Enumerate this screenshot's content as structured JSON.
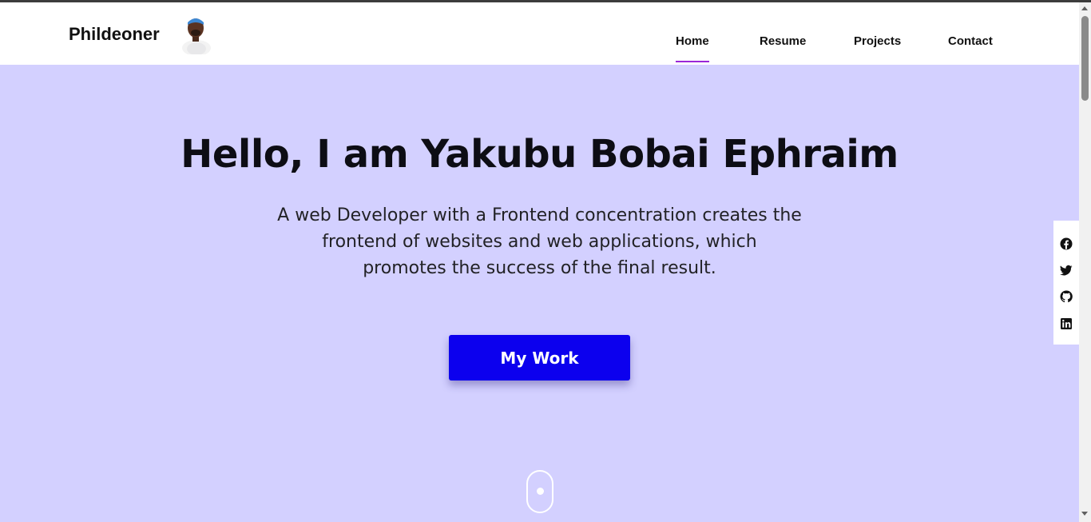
{
  "brand": {
    "name": "Phildeoner"
  },
  "nav": {
    "items": [
      {
        "label": "Home",
        "active": true
      },
      {
        "label": "Resume"
      },
      {
        "label": "Projects"
      },
      {
        "label": "Contact"
      }
    ],
    "active_color": "#9b27d8"
  },
  "hero": {
    "title": "Hello, I am Yakubu Bobai Ephraim",
    "subtitle_lines": [
      "A web Developer with a Frontend concentration creates the",
      "frontend of websites and web applications, which",
      "promotes the success of the final result."
    ],
    "cta_label": "My Work",
    "background": "#d3d0ff",
    "cta_color": "#0c00ee"
  },
  "social": {
    "icons": [
      "facebook-icon",
      "twitter-icon",
      "github-icon",
      "linkedin-icon"
    ]
  }
}
